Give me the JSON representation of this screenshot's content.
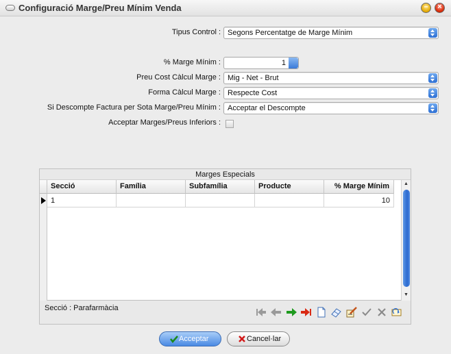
{
  "window": {
    "title": "Configuració Marge/Preu Mínim Venda"
  },
  "form": {
    "tipus_control": {
      "label": "Tipus Control :",
      "value": "Segons Percentatge de Marge Mínim"
    },
    "marge_minim": {
      "label": "% Marge Mínim :",
      "value": "1"
    },
    "preu_cost": {
      "label": "Preu Cost Càlcul Marge :",
      "value": "Mig - Net - Brut"
    },
    "forma_calcul": {
      "label": "Forma Càlcul Marge :",
      "value": "Respecte Cost"
    },
    "descompte": {
      "label": "Si Descompte Factura per Sota Marge/Preu Mínim :",
      "value": "Acceptar el Descompte"
    },
    "acceptar_inferiors": {
      "label": "Acceptar Marges/Preus Inferiors :",
      "checked": false
    }
  },
  "grid": {
    "title": "Marges Especials",
    "columns": [
      "Secció",
      "Família",
      "Subfamília",
      "Producte",
      "% Marge Mínim"
    ],
    "rows": [
      {
        "seccio": "1",
        "familia": "",
        "subfamilia": "",
        "producte": "",
        "marge": "10"
      }
    ],
    "status": "Secció : Parafarmàcia"
  },
  "buttons": {
    "accept": "Acceptar",
    "cancel": "Cancel·lar"
  },
  "colors": {
    "accent_blue": "#2d6fd3",
    "nav_green": "#1e9a1e",
    "nav_red": "#d92a14"
  }
}
